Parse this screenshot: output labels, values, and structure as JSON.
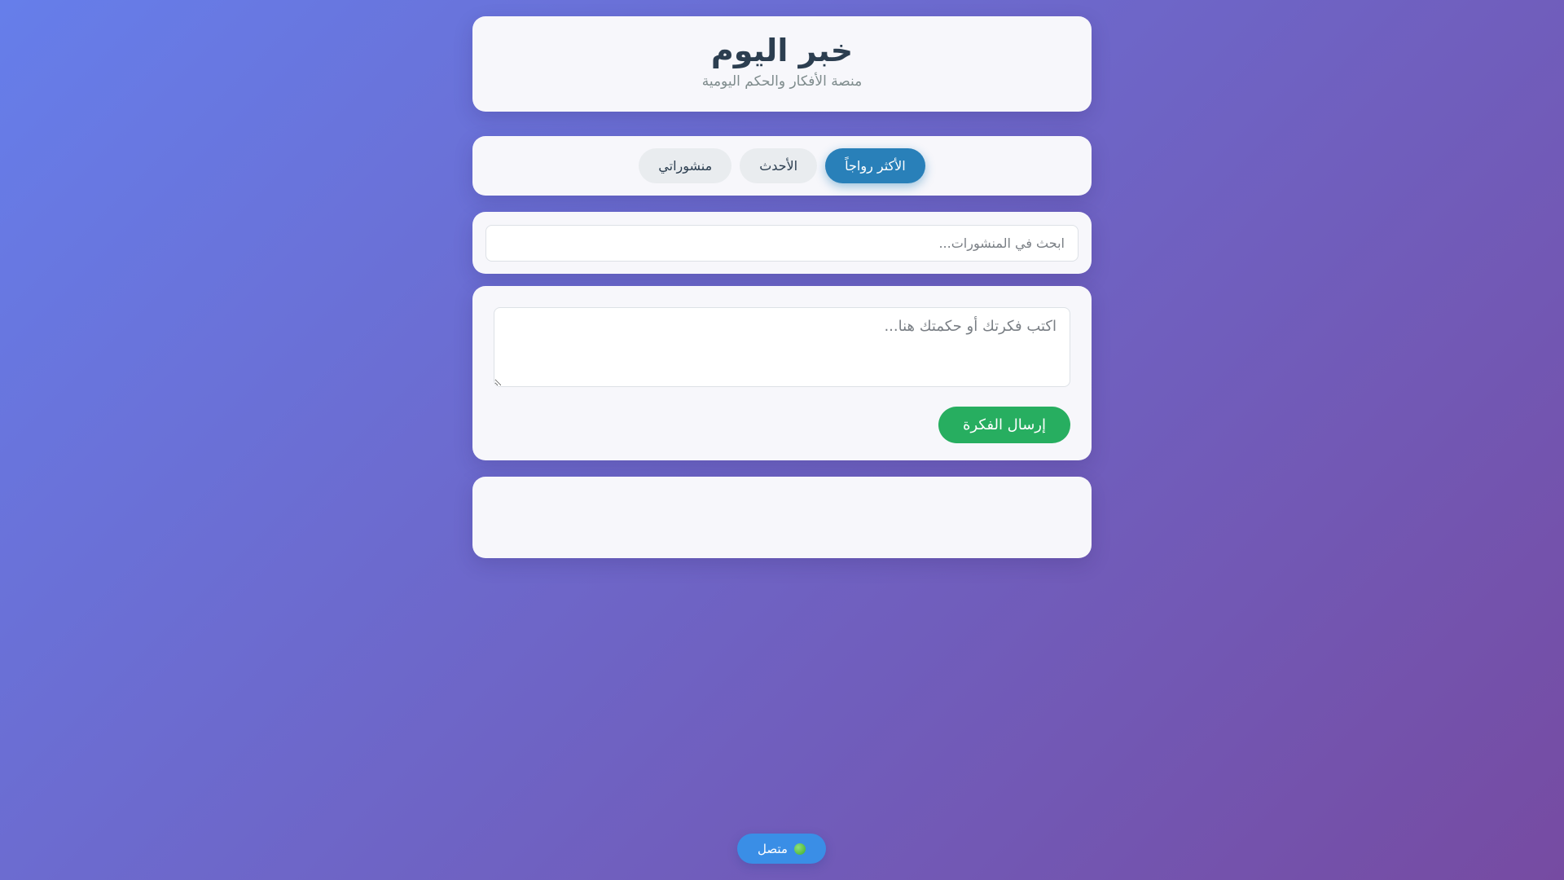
{
  "header": {
    "title": "خبر اليوم",
    "subtitle": "منصة الأفكار والحكم اليومية"
  },
  "tabs": [
    {
      "label": "الأكثر رواجاً",
      "active": true
    },
    {
      "label": "الأحدث",
      "active": false
    },
    {
      "label": "منشوراتي",
      "active": false
    }
  ],
  "search": {
    "placeholder": "ابحث في المنشورات..."
  },
  "composer": {
    "placeholder": "اكتب فكرتك أو حكمتك هنا...",
    "submit_label": "إرسال الفكرة"
  },
  "status": {
    "label": "متصل",
    "icon": "green-circle-icon",
    "color": "#3fae2a"
  },
  "colors": {
    "accent": "#2980b9",
    "submit": "#27ae60",
    "status_pill": "#3a8ee6"
  }
}
